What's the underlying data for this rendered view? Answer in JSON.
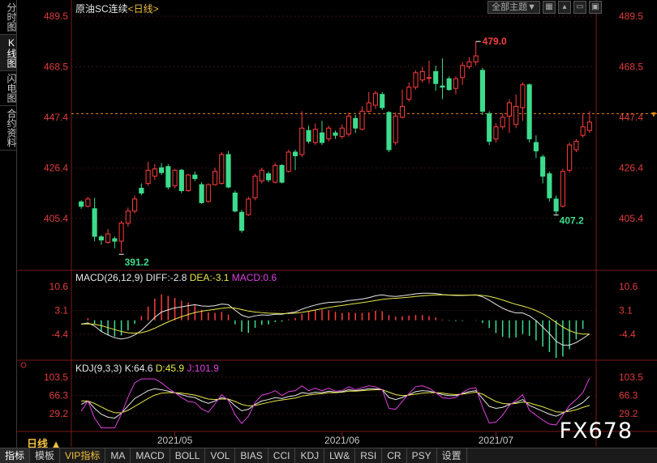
{
  "sidebar": {
    "items": [
      {
        "label": "分时图",
        "active": false
      },
      {
        "label": "K线图",
        "active": true
      },
      {
        "label": "闪电图",
        "active": false
      },
      {
        "label": "合约资料",
        "active": false
      }
    ]
  },
  "header": {
    "symbol": "原油SC连续",
    "period_tag": "<日线>",
    "main_indicator_btn": "全部主题▼"
  },
  "colors": {
    "up": "#ff3c3c",
    "down": "#3cdc8c",
    "axis_text": "#e03c3c",
    "grid": "#3a1414",
    "macd_diff": "#e8e8e8",
    "macd_dea": "#e8e84a",
    "kdj_k": "#e8e8e8",
    "kdj_d": "#e8e84a",
    "kdj_j": "#e040e0"
  },
  "price_panel": {
    "y_ticks": [
      "489.5",
      "468.5",
      "447.4",
      "426.4",
      "405.4"
    ],
    "high_label": "479.0",
    "low_label_1": "391.2",
    "low_label_2": "407.2"
  },
  "macd_panel": {
    "legend_name": "MACD(26,12,9)",
    "diff": "DIFF:-2.8",
    "dea": "DEA:-3.1",
    "macd": "MACD:0.6",
    "y_ticks": [
      "10.6",
      "3.1",
      "-4.4"
    ]
  },
  "kdj_panel": {
    "legend_name": "KDJ(9,3,3)",
    "k": "K:64.6",
    "d": "D:45.9",
    "j": "J:101.9",
    "y_ticks": [
      "103.5",
      "66.3",
      "29.2"
    ]
  },
  "x_axis": {
    "labels": [
      "2021/05",
      "2021/06",
      "2021/07"
    ]
  },
  "period_label": "日线 ▲",
  "tabs": [
    "指标",
    "模板",
    "VIP指标",
    "MA",
    "MACD",
    "BOLL",
    "VOL",
    "BIAS",
    "CCI",
    "KDJ",
    "LW&",
    "RSI",
    "CR",
    "PSY",
    "设置"
  ],
  "watermark": "FX678",
  "chart_data": {
    "type": "candlestick",
    "y_range": [
      391.2,
      489.5
    ],
    "candles": [
      {
        "o": 412.3,
        "c": 410.5,
        "h": 413.0,
        "l": 409.5
      },
      {
        "o": 410.5,
        "c": 413.5,
        "h": 414.5,
        "l": 410.0
      },
      {
        "o": 409.5,
        "c": 398.0,
        "h": 414.0,
        "l": 396.0
      },
      {
        "o": 397.8,
        "c": 396.5,
        "h": 398.5,
        "l": 394.5
      },
      {
        "o": 395.5,
        "c": 399.0,
        "h": 401.0,
        "l": 395.0
      },
      {
        "o": 397.0,
        "c": 396.0,
        "h": 398.0,
        "l": 393.0
      },
      {
        "o": 396.0,
        "c": 403.5,
        "h": 404.5,
        "l": 391.2
      },
      {
        "o": 403.5,
        "c": 408.5,
        "h": 410.0,
        "l": 402.0
      },
      {
        "o": 408.5,
        "c": 413.5,
        "h": 415.0,
        "l": 407.5
      },
      {
        "o": 418.0,
        "c": 416.0,
        "h": 420.0,
        "l": 415.0
      },
      {
        "o": 420.0,
        "c": 425.5,
        "h": 429.0,
        "l": 419.0
      },
      {
        "o": 423.0,
        "c": 426.0,
        "h": 428.0,
        "l": 421.5
      },
      {
        "o": 426.5,
        "c": 424.5,
        "h": 428.5,
        "l": 423.5
      },
      {
        "o": 427.0,
        "c": 418.5,
        "h": 428.0,
        "l": 417.5
      },
      {
        "o": 419.0,
        "c": 425.5,
        "h": 426.0,
        "l": 418.0
      },
      {
        "o": 425.5,
        "c": 417.0,
        "h": 426.0,
        "l": 416.0
      },
      {
        "o": 417.0,
        "c": 423.5,
        "h": 424.0,
        "l": 416.5
      },
      {
        "o": 423.5,
        "c": 422.0,
        "h": 425.0,
        "l": 421.0
      },
      {
        "o": 419.5,
        "c": 412.0,
        "h": 420.5,
        "l": 411.5
      },
      {
        "o": 412.5,
        "c": 419.5,
        "h": 420.0,
        "l": 412.0
      },
      {
        "o": 419.5,
        "c": 425.0,
        "h": 426.5,
        "l": 419.0
      },
      {
        "o": 420.0,
        "c": 432.0,
        "h": 433.0,
        "l": 419.5
      },
      {
        "o": 432.0,
        "c": 418.5,
        "h": 433.5,
        "l": 418.0
      },
      {
        "o": 416.0,
        "c": 408.5,
        "h": 417.0,
        "l": 408.0
      },
      {
        "o": 408.0,
        "c": 400.5,
        "h": 409.0,
        "l": 399.5
      },
      {
        "o": 407.0,
        "c": 413.5,
        "h": 414.5,
        "l": 406.5
      },
      {
        "o": 414.0,
        "c": 423.0,
        "h": 424.0,
        "l": 413.0
      },
      {
        "o": 421.0,
        "c": 425.5,
        "h": 426.5,
        "l": 420.0
      },
      {
        "o": 424.0,
        "c": 421.5,
        "h": 425.0,
        "l": 420.5
      },
      {
        "o": 420.5,
        "c": 427.5,
        "h": 428.5,
        "l": 420.0
      },
      {
        "o": 427.5,
        "c": 420.5,
        "h": 428.0,
        "l": 420.0
      },
      {
        "o": 425.0,
        "c": 433.0,
        "h": 434.0,
        "l": 424.5
      },
      {
        "o": 433.0,
        "c": 431.5,
        "h": 434.0,
        "l": 425.5
      },
      {
        "o": 432.0,
        "c": 443.0,
        "h": 450.0,
        "l": 431.0
      },
      {
        "o": 442.0,
        "c": 437.5,
        "h": 444.0,
        "l": 436.5
      },
      {
        "o": 437.0,
        "c": 442.5,
        "h": 445.0,
        "l": 436.0
      },
      {
        "o": 441.0,
        "c": 437.0,
        "h": 446.0,
        "l": 436.0
      },
      {
        "o": 438.5,
        "c": 443.0,
        "h": 444.0,
        "l": 437.5
      },
      {
        "o": 441.0,
        "c": 440.0,
        "h": 442.0,
        "l": 438.5
      },
      {
        "o": 439.5,
        "c": 443.0,
        "h": 444.5,
        "l": 438.5
      },
      {
        "o": 440.5,
        "c": 448.0,
        "h": 449.5,
        "l": 439.5
      },
      {
        "o": 447.0,
        "c": 443.0,
        "h": 448.5,
        "l": 441.0
      },
      {
        "o": 442.5,
        "c": 450.0,
        "h": 452.0,
        "l": 442.0
      },
      {
        "o": 450.0,
        "c": 453.5,
        "h": 458.0,
        "l": 449.5
      },
      {
        "o": 452.5,
        "c": 457.5,
        "h": 458.5,
        "l": 451.0
      },
      {
        "o": 457.0,
        "c": 451.5,
        "h": 458.0,
        "l": 450.5
      },
      {
        "o": 449.5,
        "c": 434.0,
        "h": 450.0,
        "l": 433.0
      },
      {
        "o": 437.0,
        "c": 448.0,
        "h": 449.5,
        "l": 436.0
      },
      {
        "o": 447.5,
        "c": 452.0,
        "h": 459.0,
        "l": 447.0
      },
      {
        "o": 455.0,
        "c": 460.0,
        "h": 462.0,
        "l": 454.0
      },
      {
        "o": 460.0,
        "c": 466.0,
        "h": 467.0,
        "l": 459.0
      },
      {
        "o": 463.0,
        "c": 466.5,
        "h": 468.5,
        "l": 462.0
      },
      {
        "o": 464.0,
        "c": 464.0,
        "h": 471.0,
        "l": 461.5
      },
      {
        "o": 466.5,
        "c": 461.5,
        "h": 469.0,
        "l": 458.5
      },
      {
        "o": 460.5,
        "c": 460.0,
        "h": 472.0,
        "l": 455.0
      },
      {
        "o": 463.5,
        "c": 459.0,
        "h": 464.5,
        "l": 458.5
      },
      {
        "o": 459.5,
        "c": 463.5,
        "h": 464.5,
        "l": 457.0
      },
      {
        "o": 464.0,
        "c": 469.0,
        "h": 470.5,
        "l": 461.0
      },
      {
        "o": 468.5,
        "c": 470.5,
        "h": 472.5,
        "l": 467.5
      },
      {
        "o": 470.5,
        "c": 473.0,
        "h": 479.0,
        "l": 469.0
      },
      {
        "o": 467.0,
        "c": 450.0,
        "h": 468.0,
        "l": 448.5
      },
      {
        "o": 449.0,
        "c": 437.5,
        "h": 450.0,
        "l": 436.0
      },
      {
        "o": 438.5,
        "c": 443.5,
        "h": 445.0,
        "l": 437.0
      },
      {
        "o": 443.5,
        "c": 447.5,
        "h": 449.0,
        "l": 442.5
      },
      {
        "o": 448.0,
        "c": 453.5,
        "h": 455.0,
        "l": 441.0
      },
      {
        "o": 444.5,
        "c": 452.0,
        "h": 457.0,
        "l": 443.0
      },
      {
        "o": 451.5,
        "c": 461.0,
        "h": 462.0,
        "l": 446.0
      },
      {
        "o": 461.0,
        "c": 438.5,
        "h": 461.5,
        "l": 437.0
      },
      {
        "o": 437.0,
        "c": 433.5,
        "h": 440.0,
        "l": 430.5
      },
      {
        "o": 431.0,
        "c": 423.0,
        "h": 432.0,
        "l": 420.0
      },
      {
        "o": 424.0,
        "c": 414.0,
        "h": 425.0,
        "l": 412.5
      },
      {
        "o": 413.5,
        "c": 408.5,
        "h": 415.0,
        "l": 407.2
      },
      {
        "o": 410.5,
        "c": 425.0,
        "h": 426.0,
        "l": 410.0
      },
      {
        "o": 425.5,
        "c": 436.0,
        "h": 437.0,
        "l": 424.5
      },
      {
        "o": 434.0,
        "c": 437.5,
        "h": 438.5,
        "l": 433.0
      },
      {
        "o": 440.0,
        "c": 443.5,
        "h": 449.0,
        "l": 439.0
      },
      {
        "o": 442.0,
        "c": 445.5,
        "h": 450.0,
        "l": 441.0
      }
    ],
    "macd": {
      "range": [
        -10.5,
        13.0
      ],
      "diff": [
        -1.2,
        -0.8,
        -1.8,
        -3.5,
        -4.6,
        -5.5,
        -5.9,
        -5.5,
        -4.6,
        -3.2,
        -1.2,
        0.9,
        2.6,
        3.3,
        3.9,
        4.2,
        4.6,
        4.9,
        4.5,
        4.4,
        4.6,
        5.1,
        4.9,
        3.2,
        1.6,
        0.9,
        1.4,
        1.7,
        1.6,
        1.9,
        1.9,
        2.3,
        2.6,
        3.5,
        4.2,
        4.8,
        5.3,
        5.6,
        5.7,
        5.8,
        6.2,
        6.4,
        6.7,
        7.1,
        7.7,
        8.0,
        7.6,
        7.5,
        7.7,
        8.0,
        8.3,
        8.5,
        8.5,
        8.4,
        8.1,
        7.9,
        7.8,
        7.8,
        7.9,
        8.0,
        7.4,
        6.3,
        5.0,
        3.8,
        2.9,
        2.3,
        2.3,
        1.4,
        -0.1,
        -2.1,
        -4.2,
        -6.6,
        -7.8,
        -7.8,
        -7.0,
        -5.7,
        -4.3
      ]
    },
    "kdj": {
      "range": [
        5.0,
        110.0
      ],
      "k": [
        48,
        55,
        40,
        28,
        22,
        20,
        30,
        45,
        60,
        68,
        76,
        80,
        78,
        75,
        72,
        68,
        64,
        62,
        55,
        50,
        55,
        62,
        58,
        45,
        35,
        38,
        48,
        55,
        58,
        62,
        60,
        64,
        66,
        72,
        70,
        73,
        72,
        75,
        73,
        74,
        78,
        76,
        78,
        80,
        80,
        78,
        62,
        58,
        62,
        68,
        74,
        76,
        75,
        72,
        68,
        66,
        66,
        70,
        74,
        76,
        60,
        44,
        40,
        42,
        48,
        52,
        58,
        46,
        40,
        34,
        28,
        24,
        30,
        38,
        44,
        52,
        64.6
      ],
      "d": [
        55,
        55,
        50,
        43,
        36,
        31,
        31,
        36,
        44,
        52,
        60,
        67,
        71,
        72,
        72,
        71,
        69,
        67,
        63,
        59,
        58,
        59,
        59,
        54,
        48,
        45,
        46,
        49,
        52,
        55,
        57,
        59,
        61,
        65,
        67,
        69,
        70,
        72,
        72,
        73,
        75,
        75,
        76,
        77,
        78,
        78,
        73,
        68,
        66,
        67,
        69,
        71,
        72,
        72,
        71,
        69,
        68,
        69,
        71,
        73,
        69,
        61,
        54,
        50,
        49,
        50,
        53,
        51,
        47,
        43,
        38,
        33,
        32,
        34,
        37,
        42,
        45.9
      ],
      "j": [
        34,
        55,
        20,
        0,
        0,
        0,
        28,
        63,
        92,
        100,
        100,
        100,
        92,
        81,
        72,
        62,
        54,
        52,
        39,
        32,
        49,
        68,
        56,
        27,
        9,
        24,
        52,
        67,
        70,
        76,
        66,
        74,
        76,
        86,
        76,
        81,
        76,
        81,
        75,
        76,
        84,
        78,
        82,
        86,
        84,
        78,
        40,
        38,
        54,
        70,
        84,
        86,
        81,
        72,
        62,
        60,
        62,
        72,
        80,
        82,
        42,
        10,
        12,
        26,
        46,
        56,
        68,
        36,
        26,
        16,
        8,
        6,
        26,
        46,
        58,
        72,
        101.9
      ]
    }
  }
}
